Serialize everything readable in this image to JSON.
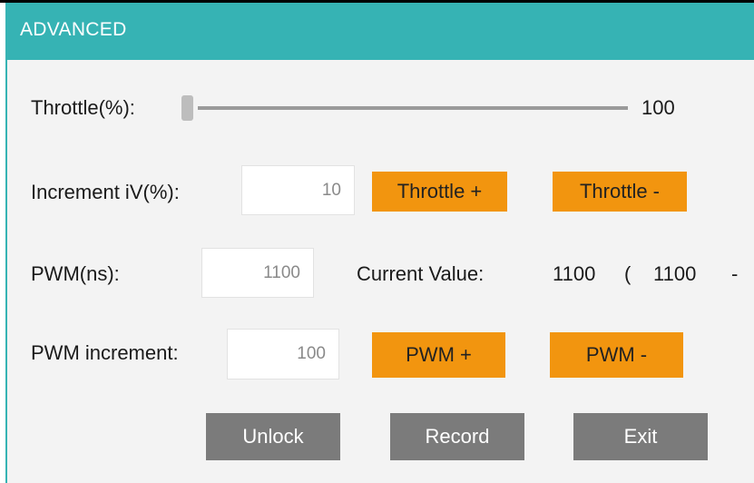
{
  "window": {
    "title": "ADVANCED"
  },
  "throttle": {
    "label": "Throttle(%):",
    "value": "100",
    "slider_position": 0
  },
  "increment": {
    "label": "Increment iV(%):",
    "value": "10"
  },
  "pwm": {
    "label": "PWM(ns):",
    "value": "1100"
  },
  "current": {
    "label": "Current Value:",
    "value": "1100",
    "range_open": "(",
    "range_start": "1100",
    "range_dash": "-"
  },
  "pwm_increment": {
    "label": "PWM increment:",
    "value": "100"
  },
  "buttons": {
    "throttle_plus": "Throttle +",
    "throttle_minus": "Throttle -",
    "pwm_plus": "PWM +",
    "pwm_minus": "PWM -",
    "unlock": "Unlock",
    "record": "Record",
    "exit": "Exit"
  },
  "colors": {
    "header": "#36b3b4",
    "accent_button": "#f2950f",
    "action_button": "#7b7b7b"
  }
}
